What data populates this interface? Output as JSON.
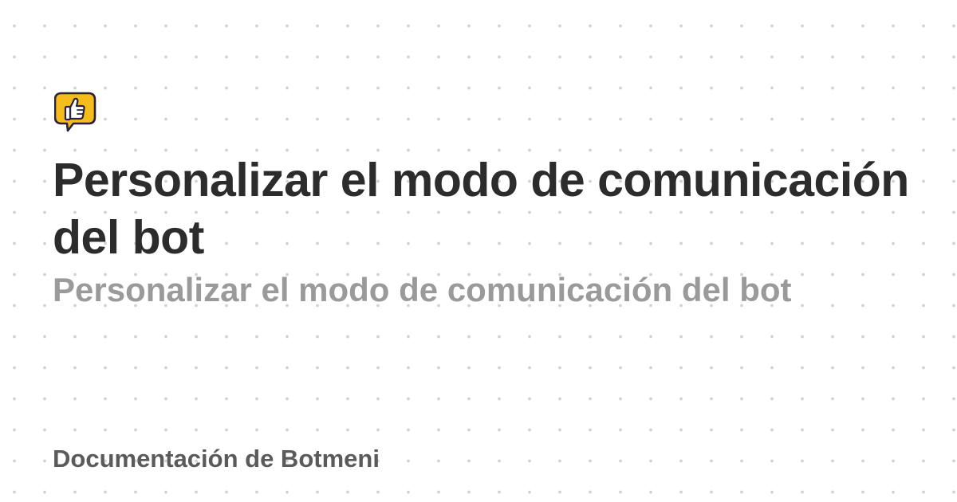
{
  "logo": {
    "icon": "thumbs-up-speech-bubble-icon",
    "color": "#f5bd1c",
    "outline_color": "#2a2140"
  },
  "page": {
    "title": "Personalizar el modo de comunicación del bot",
    "subtitle": "Personalizar el modo de comunicación del bot",
    "site_name": "Documentación de Botmeni"
  },
  "colors": {
    "background": "#ffffff",
    "dot_pattern": "#d2d2d2",
    "title": "#2c2c2c",
    "subtitle": "#9a9a9a",
    "site_name": "#5a5a5a"
  }
}
